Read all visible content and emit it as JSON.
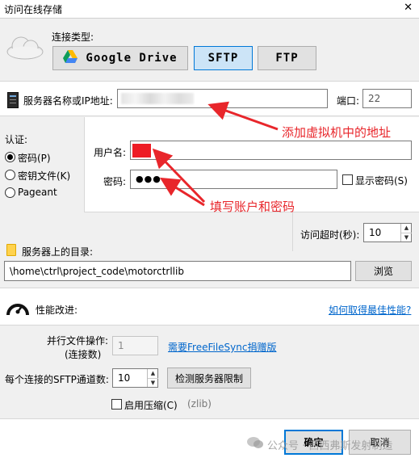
{
  "window": {
    "title": "访问在线存储",
    "close_symbol": "✕"
  },
  "connection": {
    "type_label": "连接类型:",
    "options": [
      "Google Drive",
      "SFTP",
      "FTP"
    ],
    "selected": "SFTP"
  },
  "server": {
    "name_label": "服务器名称或IP地址:",
    "name_value": "",
    "port_label": "端口:",
    "port_value": "22"
  },
  "auth": {
    "label": "认证:",
    "methods": [
      "密码(P)",
      "密钥文件(K)",
      "Pageant"
    ],
    "selected": "密码(P)",
    "username_label": "用户名:",
    "username_value": "",
    "password_label": "密码:",
    "password_value": "●●●",
    "show_password_label": "显示密码(S)"
  },
  "timeout": {
    "label": "访问超时(秒):",
    "value": "10"
  },
  "directory": {
    "label": "服务器上的目录:",
    "value": "\\home\\ctrl\\project_code\\motorctrllib",
    "browse_label": "浏览"
  },
  "performance": {
    "label": "性能改进:",
    "help_link": "如何取得最佳性能?",
    "parallel_label_1": "并行文件操作:",
    "parallel_label_2": "(连接数)",
    "parallel_value": "1",
    "donation_link": "需要FreeFileSync捐赠版",
    "channels_label": "每个连接的SFTP通道数:",
    "channels_value": "10",
    "detect_button": "检测服务器限制",
    "compression_label": "启用压缩(C)",
    "compression_note": "(zlib)"
  },
  "footer": {
    "ok": "确定",
    "cancel": "取消"
  },
  "annotations": {
    "server_note": "添加虚拟机中的地址",
    "credentials_note": "填写账户和密码",
    "watermark": "公众号 · 西西弗斯发射制造"
  },
  "colors": {
    "annotation": "#e8262b",
    "accent": "#0078d7",
    "link": "#0066cc"
  }
}
